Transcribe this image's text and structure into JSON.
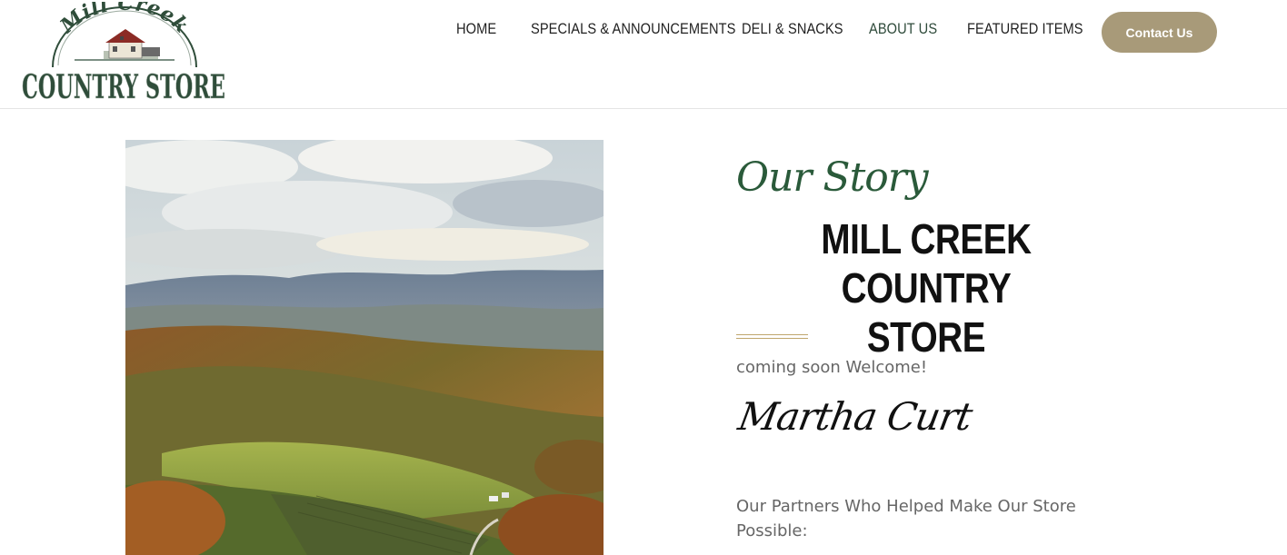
{
  "logo": {
    "top_text": "Mill Creek",
    "bottom_text": "COUNTRY STORE"
  },
  "nav": {
    "items": [
      {
        "label": "HOME"
      },
      {
        "label": "SPECIALS & ANNOUNCEMENTS"
      },
      {
        "label": "DELI & SNACKS"
      },
      {
        "label": "ABOUT US",
        "active": true
      },
      {
        "label": "FEATURED ITEMS"
      }
    ],
    "contact_label": "Contact Us"
  },
  "colors": {
    "accent_tan": "#a89a79",
    "script_green": "#2a5a3a",
    "divider_gold": "#bfa66d"
  },
  "story": {
    "script_heading": "Our Story",
    "title_line1": "MILL CREEK COUNTRY",
    "title_line2": "STORE",
    "welcome": "coming soon Welcome!",
    "signature": "Martha Curt",
    "partners": "Our Partners Who Helped Make Our Store Possible:"
  },
  "hero_image": {
    "description_icon": "landscape-photo"
  }
}
